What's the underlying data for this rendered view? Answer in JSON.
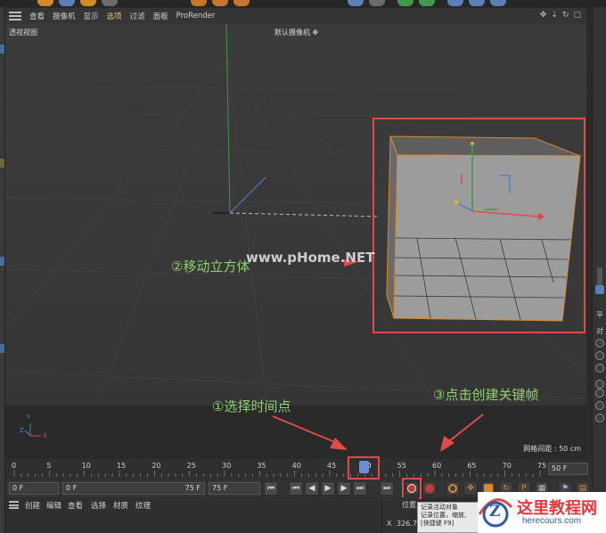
{
  "menubar": {
    "items": [
      "查看",
      "摄像机",
      "显示",
      "选项",
      "过滤",
      "面板",
      "ProRender"
    ],
    "selected_index": 3
  },
  "viewport": {
    "label_left": "透视视图",
    "camera_label": "默认摄像机",
    "grid_info": "网格间距 : 50 cm",
    "watermark": "www.pHome.NET",
    "axis_labels": {
      "y": "Y",
      "z": "Z",
      "x": "X"
    }
  },
  "annotations": {
    "move_cube": "②移动立方体",
    "select_time": "①选择时间点",
    "create_key": "③点击创建关键帧"
  },
  "timeline": {
    "ticks": [
      "0",
      "5",
      "10",
      "15",
      "20",
      "25",
      "30",
      "35",
      "40",
      "45",
      "50",
      "55",
      "60",
      "65",
      "70",
      "75"
    ],
    "current_frame": 50,
    "end_field": "50 F"
  },
  "transport": {
    "start_field": "0 F",
    "range_start": "0 F",
    "range_end": "75 F",
    "max_field": "75 F"
  },
  "bottom_menu": {
    "items": [
      "创建",
      "编辑",
      "查看",
      "选择",
      "材质",
      "纹理"
    ]
  },
  "coord_panel": {
    "title": "位置",
    "x_label": "X",
    "x_value": "326.7"
  },
  "tooltip": {
    "line1": "记录活动对象",
    "line2": "记录位置，缩放,",
    "line3": "[快捷键 F9]"
  },
  "right_panel": {
    "tab1": "平",
    "tab2": "对"
  },
  "logo": {
    "text_cn": "这里教程网",
    "text_url": "herecours.com",
    "letter": "Z"
  },
  "colors": {
    "highlight_frame": "#e04a4a",
    "annotation_text": "#8fd16b",
    "selection_orange": "#d98a2a",
    "selected_menu": "#e9c94e"
  }
}
